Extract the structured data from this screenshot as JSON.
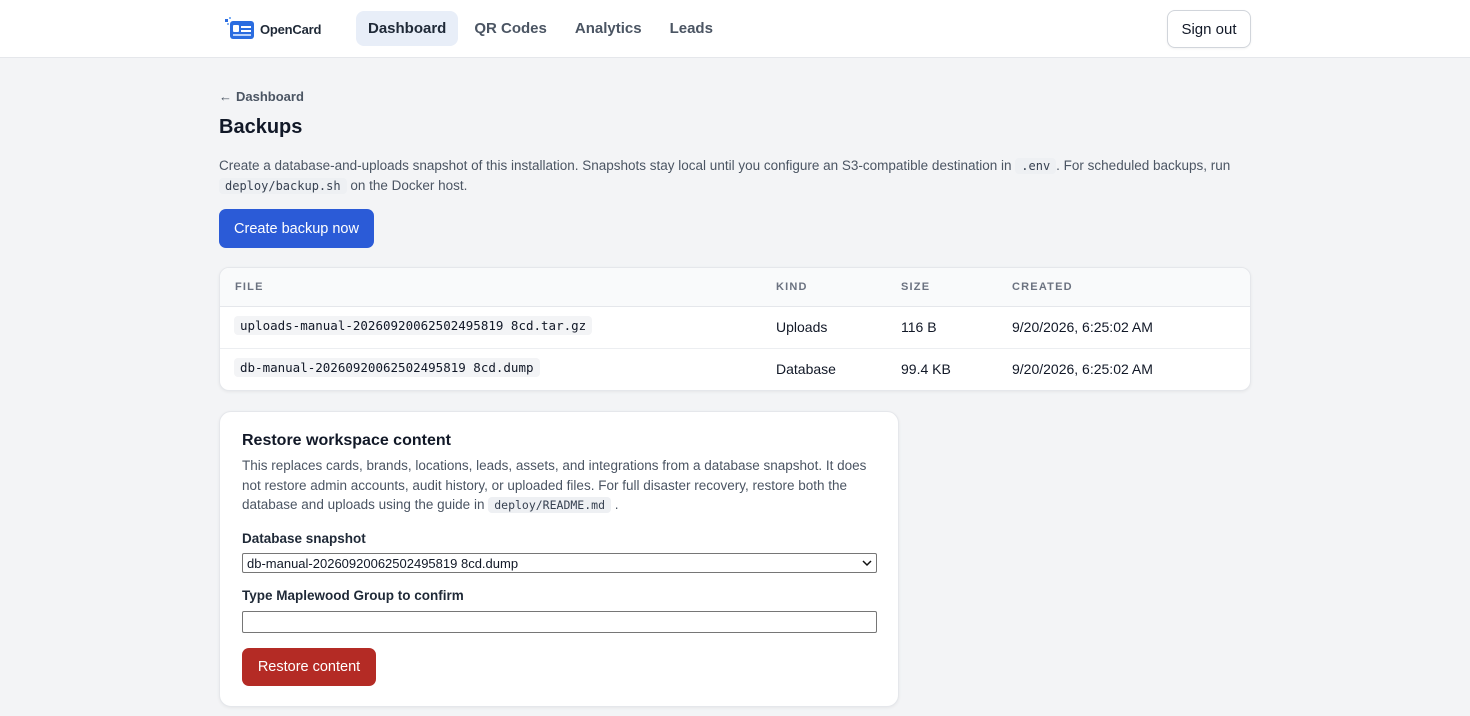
{
  "header": {
    "brand": "OpenCard",
    "nav": [
      {
        "label": "Dashboard",
        "active": true
      },
      {
        "label": "QR Codes",
        "active": false
      },
      {
        "label": "Analytics",
        "active": false
      },
      {
        "label": "Leads",
        "active": false
      }
    ],
    "sign_out": "Sign out"
  },
  "page": {
    "back_label": "Dashboard",
    "title": "Backups",
    "desc_part1": "Create a database-and-uploads snapshot of this installation. Snapshots stay local until you configure an S3-compatible destination in",
    "desc_code1": ".env",
    "desc_part2": ". For scheduled backups, run",
    "desc_code2": "deploy/backup.sh",
    "desc_part3": "on the Docker host.",
    "create_button": "Create backup now"
  },
  "table": {
    "columns": [
      "FILE",
      "KIND",
      "SIZE",
      "CREATED"
    ],
    "rows": [
      {
        "file": "uploads-manual-20260920062502495819 8cd.tar.gz",
        "kind": "Uploads",
        "size": "116 B",
        "created": "9/20/2026, 6:25:02 AM"
      },
      {
        "file": "db-manual-20260920062502495819 8cd.dump",
        "kind": "Database",
        "size": "99.4 KB",
        "created": "9/20/2026, 6:25:02 AM"
      }
    ]
  },
  "restore": {
    "title": "Restore workspace content",
    "desc_part1": "This replaces cards, brands, locations, leads, assets, and integrations from a database snapshot. It does not restore admin accounts, audit history, or uploaded files. For full disaster recovery, restore both the database and uploads using the guide in",
    "desc_code": "deploy/README.md",
    "desc_part2": ".",
    "snapshot_label": "Database snapshot",
    "snapshot_value": "db-manual-20260920062502495819 8cd.dump",
    "confirm_label": "Type Maplewood Group to confirm",
    "confirm_value": "",
    "restore_button": "Restore content"
  },
  "colors": {
    "primary": "#2b5bd7",
    "danger": "#b42b25",
    "nav_active_bg": "#e8eef8"
  }
}
